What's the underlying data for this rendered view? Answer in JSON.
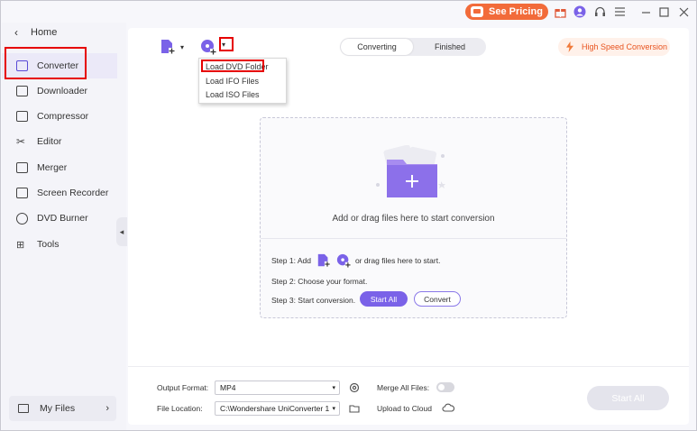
{
  "titlebar": {
    "pricing_label": "See Pricing",
    "icons": [
      "gift-icon",
      "user-avatar-icon",
      "headset-icon",
      "menu-icon",
      "minimize-icon",
      "maximize-icon",
      "close-icon"
    ]
  },
  "sidebar": {
    "home_label": "Home",
    "items": [
      {
        "label": "Converter",
        "icon": "converter-icon",
        "active": true
      },
      {
        "label": "Downloader",
        "icon": "downloader-icon"
      },
      {
        "label": "Compressor",
        "icon": "compressor-icon"
      },
      {
        "label": "Editor",
        "icon": "scissors-icon"
      },
      {
        "label": "Merger",
        "icon": "merger-icon"
      },
      {
        "label": "Screen Recorder",
        "icon": "screen-recorder-icon"
      },
      {
        "label": "DVD Burner",
        "icon": "dvd-icon"
      },
      {
        "label": "Tools",
        "icon": "tools-icon"
      }
    ],
    "my_files_label": "My Files"
  },
  "toolbar": {
    "tabs": [
      {
        "label": "Converting"
      },
      {
        "label": "Finished"
      }
    ],
    "high_speed_label": "High Speed Conversion"
  },
  "dropdown": {
    "items": [
      "Load DVD Folder",
      "Load IFO Files",
      "Load ISO Files"
    ]
  },
  "dropzone": {
    "main_text": "Add or drag files here to start conversion",
    "step1_prefix": "Step 1: Add",
    "step1_suffix": "or drag files here to start.",
    "step2": "Step 2: Choose your format.",
    "step3": "Step 3: Start conversion.",
    "start_all_label": "Start All",
    "convert_label": "Convert"
  },
  "bottom": {
    "output_format_label": "Output Format:",
    "output_format_value": "MP4",
    "file_location_label": "File Location:",
    "file_location_value": "C:\\Wondershare UniConverter 1",
    "merge_label": "Merge All Files:",
    "upload_label": "Upload to Cloud",
    "start_all_label": "Start All"
  },
  "colors": {
    "accent": "#7a62e8",
    "pricing": "#f26b3a",
    "highlight_box": "#e60000"
  }
}
